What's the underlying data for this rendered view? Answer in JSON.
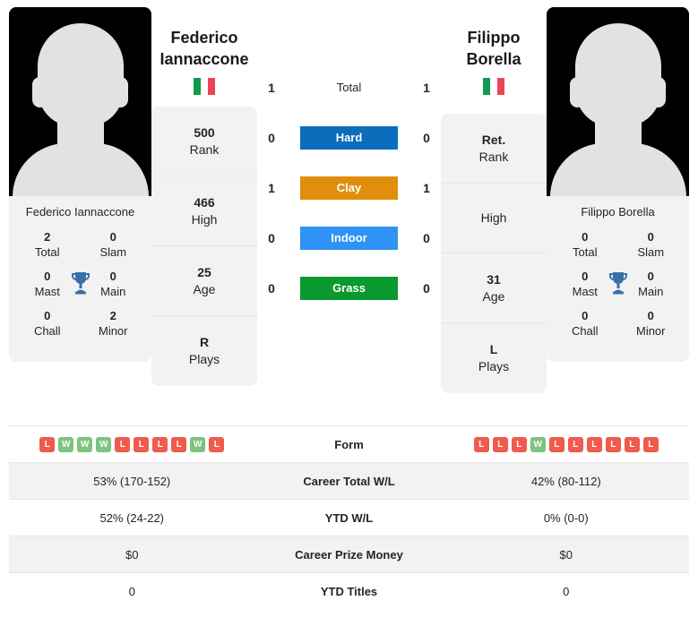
{
  "left_player": {
    "first_name": "Federico",
    "last_name": "Iannaccone",
    "full_name": "Federico Iannaccone",
    "country_flag": "italy-flag",
    "info": [
      {
        "value": "500",
        "label": "Rank"
      },
      {
        "value": "466",
        "label": "High"
      },
      {
        "value": "25",
        "label": "Age"
      },
      {
        "value": "R",
        "label": "Plays"
      }
    ],
    "titles": [
      {
        "value": "2",
        "label": "Total"
      },
      {
        "value": "0",
        "label": "Slam"
      },
      {
        "value": "0",
        "label": "Mast"
      },
      {
        "value": "0",
        "label": "Main"
      },
      {
        "value": "0",
        "label": "Chall"
      },
      {
        "value": "2",
        "label": "Minor"
      }
    ],
    "form": [
      "L",
      "W",
      "W",
      "W",
      "L",
      "L",
      "L",
      "L",
      "W",
      "L"
    ],
    "career_total_wl": "53% (170-152)",
    "ytd_wl": "52% (24-22)",
    "career_prize_money": "$0",
    "ytd_titles": "0"
  },
  "right_player": {
    "first_name": "Filippo",
    "last_name": "Borella",
    "full_name": "Filippo Borella",
    "country_flag": "italy-flag",
    "info": [
      {
        "value": "Ret.",
        "label": "Rank"
      },
      {
        "value": "",
        "label": "High"
      },
      {
        "value": "31",
        "label": "Age"
      },
      {
        "value": "L",
        "label": "Plays"
      }
    ],
    "titles": [
      {
        "value": "0",
        "label": "Total"
      },
      {
        "value": "0",
        "label": "Slam"
      },
      {
        "value": "0",
        "label": "Mast"
      },
      {
        "value": "0",
        "label": "Main"
      },
      {
        "value": "0",
        "label": "Chall"
      },
      {
        "value": "0",
        "label": "Minor"
      }
    ],
    "form": [
      "L",
      "L",
      "L",
      "W",
      "L",
      "L",
      "L",
      "L",
      "L",
      "L"
    ],
    "career_total_wl": "42% (80-112)",
    "ytd_wl": "0% (0-0)",
    "career_prize_money": "$0",
    "ytd_titles": "0"
  },
  "head_to_head": [
    {
      "label": "Total",
      "left": "1",
      "right": "1",
      "color": ""
    },
    {
      "label": "Hard",
      "left": "0",
      "right": "0",
      "color": "#0a6ebd"
    },
    {
      "label": "Clay",
      "left": "1",
      "right": "1",
      "color": "#e08e0b"
    },
    {
      "label": "Indoor",
      "left": "0",
      "right": "0",
      "color": "#2f93f5"
    },
    {
      "label": "Grass",
      "left": "0",
      "right": "0",
      "color": "#09992f"
    }
  ],
  "table": {
    "rows": [
      {
        "label": "Form",
        "type": "form"
      },
      {
        "label": "Career Total W/L",
        "left": "53% (170-152)",
        "right": "42% (80-112)"
      },
      {
        "label": "YTD W/L",
        "left": "52% (24-22)",
        "right": "0% (0-0)"
      },
      {
        "label": "Career Prize Money",
        "left": "$0",
        "right": "$0"
      },
      {
        "label": "YTD Titles",
        "left": "0",
        "right": "0"
      }
    ]
  },
  "colors": {
    "win": "#7cc47f",
    "loss": "#ef5b4c",
    "card_bg": "#f2f2f2",
    "trophy": "#3b6fa8"
  }
}
